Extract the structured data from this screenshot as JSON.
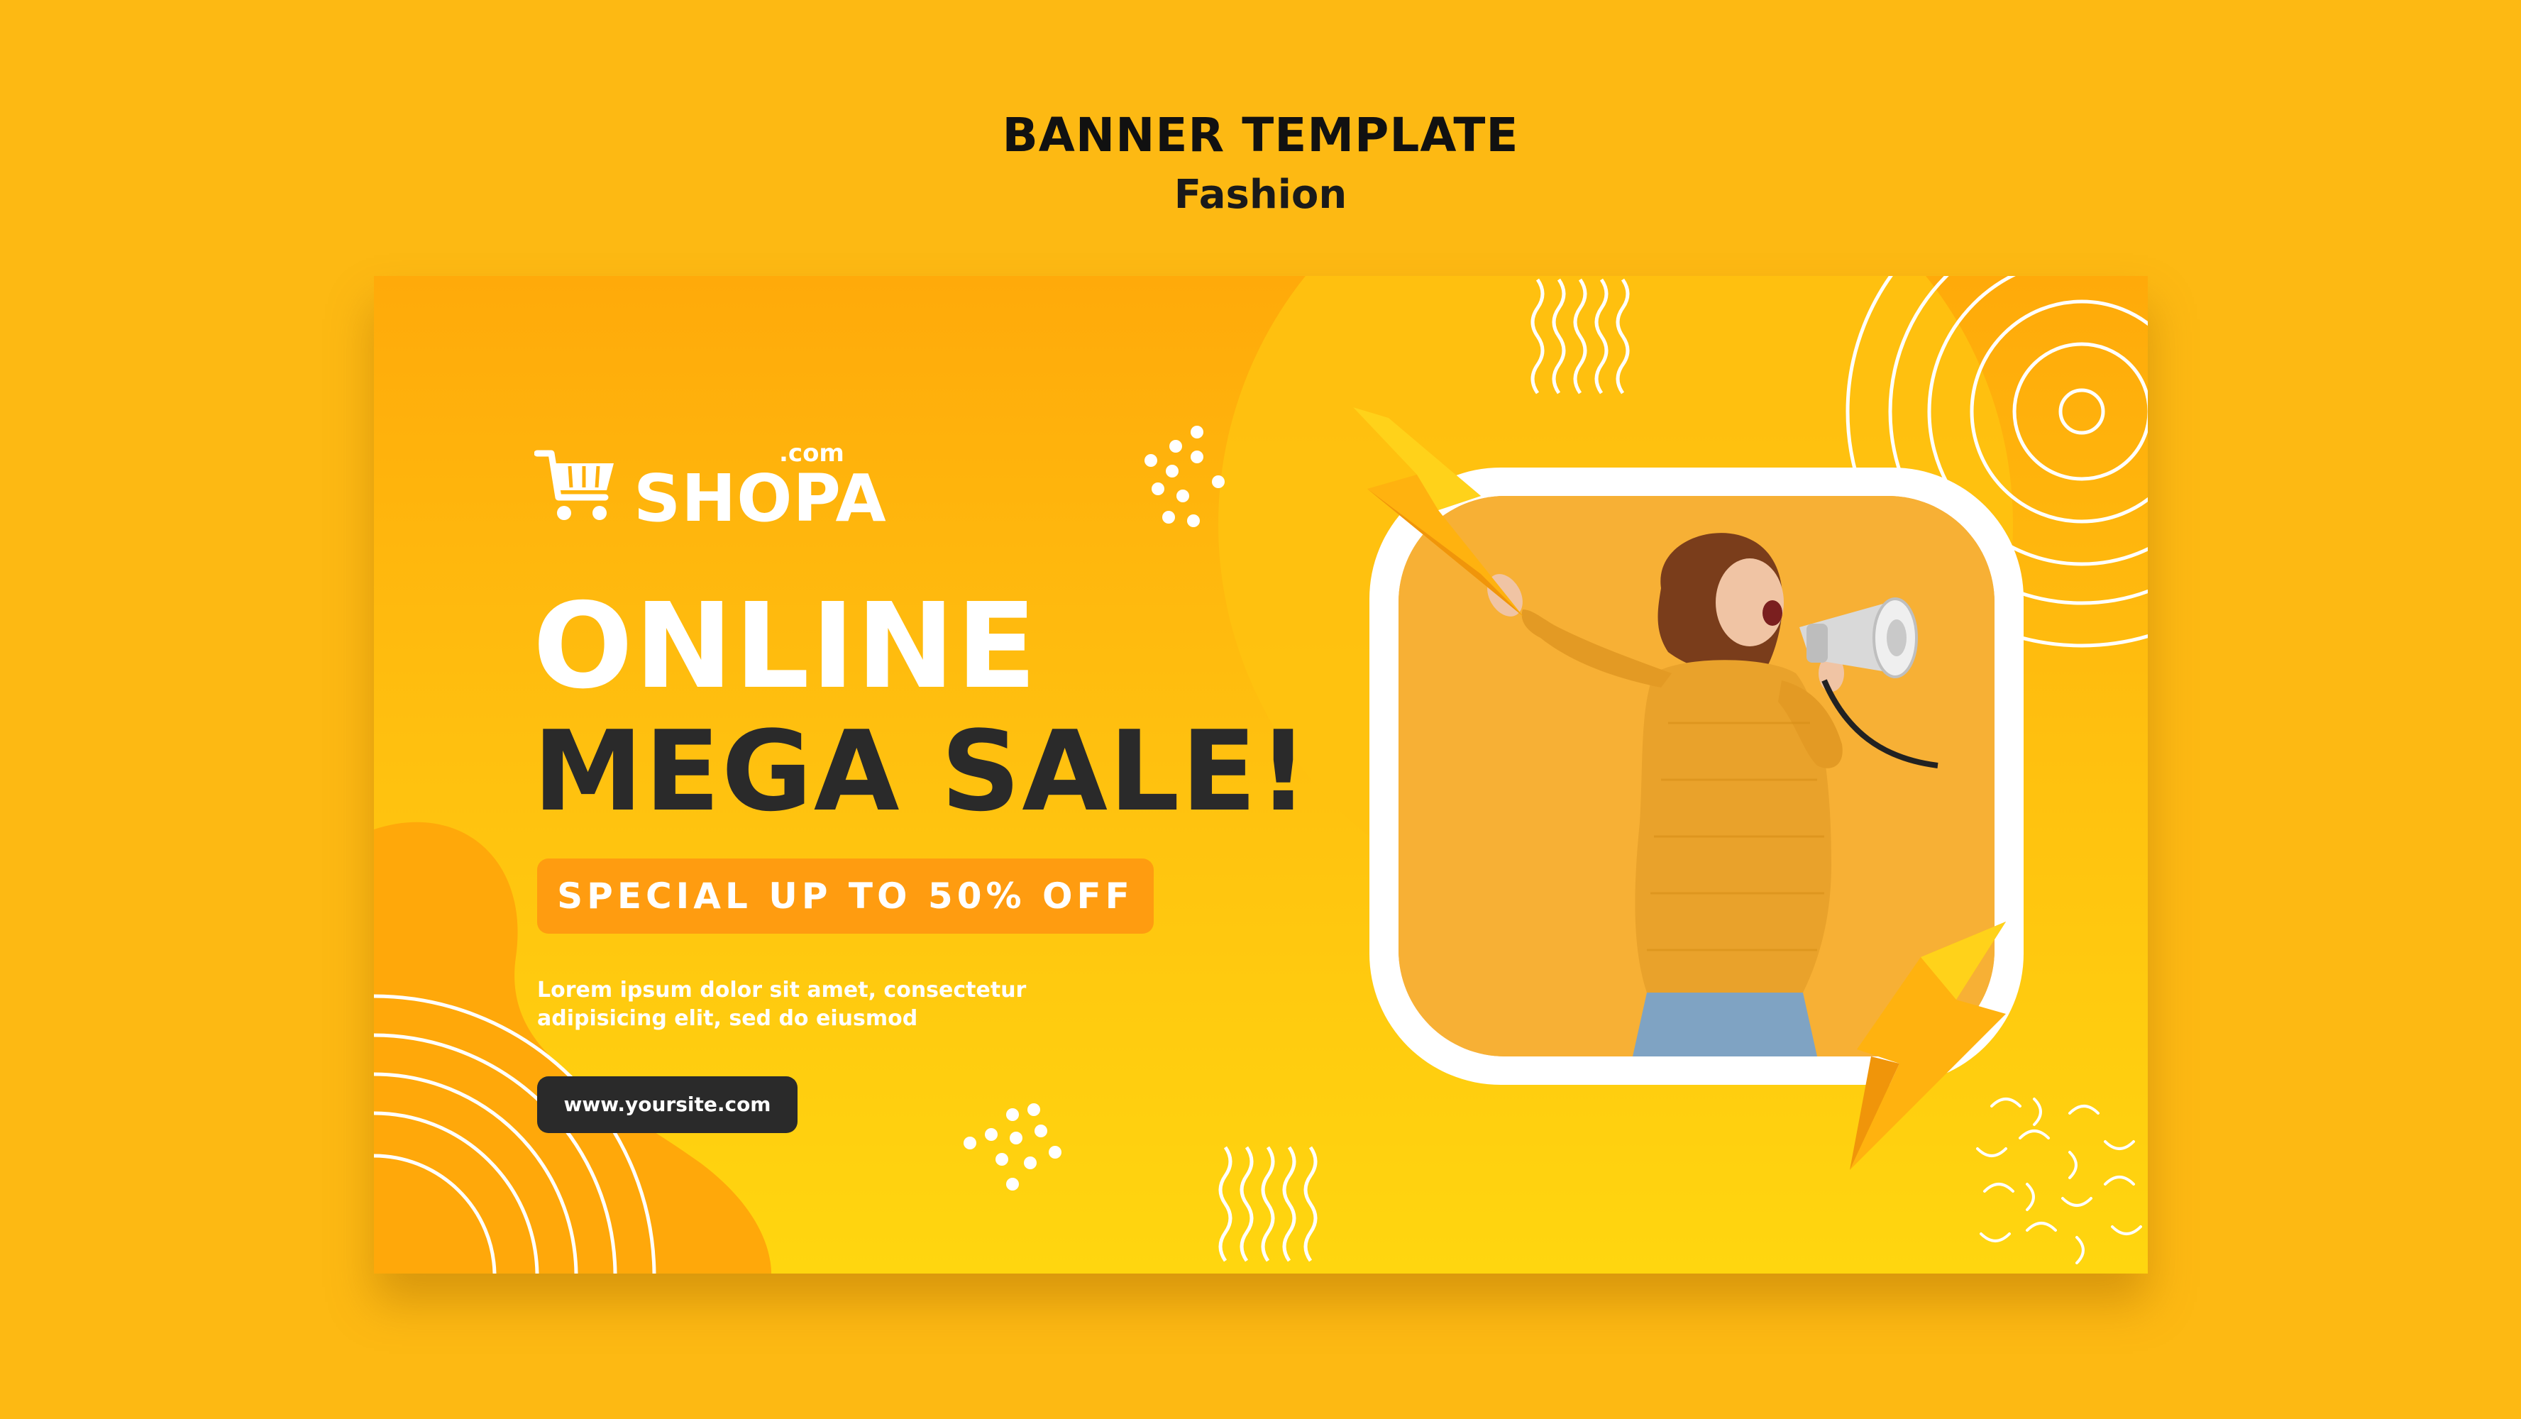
{
  "header": {
    "title": "BANNER TEMPLATE",
    "subtitle": "Fashion"
  },
  "banner": {
    "logo": {
      "name": "SHOPA",
      "suffix": ".com"
    },
    "headline_line1": "ONLINE",
    "headline_line2": "MEGA SALE!",
    "promo": "SPECIAL UP TO 50% OFF",
    "description_line1": "Lorem ipsum dolor sit amet, consectetur",
    "description_line2": "adipisicing elit, sed do eiusmod",
    "url": "www.yoursite.com"
  },
  "colors": {
    "background": "#fdb913",
    "banner_top": "#ffaa0a",
    "banner_bottom": "#ffd60f",
    "promo_badge": "#ff9c10",
    "dark_text": "#2a2a2a",
    "white": "#ffffff"
  },
  "icons": [
    "shopping-cart-icon",
    "lightning-bolt-icon",
    "megaphone-icon"
  ]
}
